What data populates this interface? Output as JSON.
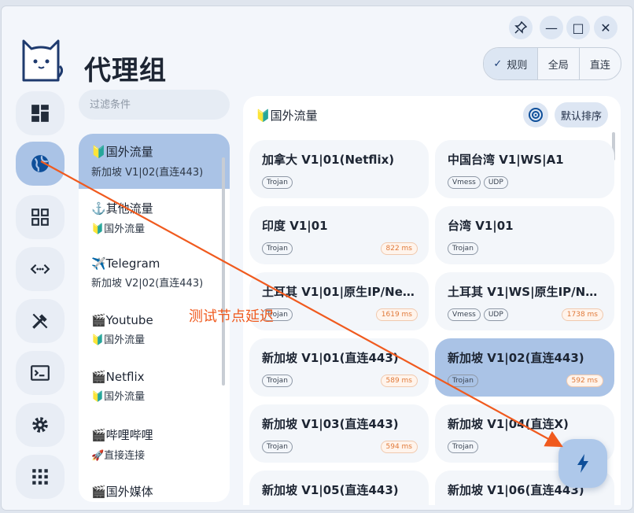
{
  "page": {
    "title": "代理组"
  },
  "window_controls": {
    "pin": "pin-icon",
    "minimize": "—",
    "maximize": "□",
    "close": "✕"
  },
  "mode": {
    "options": [
      "规则",
      "全局",
      "直连"
    ],
    "selected": "规则",
    "check": "✓"
  },
  "filter": {
    "placeholder": "过滤条件"
  },
  "sidebar": {
    "items": [
      {
        "icon": "dashboard-icon",
        "active": false
      },
      {
        "icon": "globe-icon",
        "active": true
      },
      {
        "icon": "grid-icon",
        "active": false
      },
      {
        "icon": "code-icon",
        "active": false
      },
      {
        "icon": "tools-icon",
        "active": false
      },
      {
        "icon": "terminal-icon",
        "active": false
      },
      {
        "icon": "gear-icon",
        "active": false
      },
      {
        "icon": "apps-icon",
        "active": false
      }
    ]
  },
  "groups": [
    {
      "name": "🔰国外流量",
      "sub": "新加坡 V1|02(直连443)",
      "active": true
    },
    {
      "name": "⚓️其他流量",
      "sub": "🔰国外流量",
      "active": false
    },
    {
      "name": "✈️Telegram",
      "sub": "新加坡 V2|02(直连443)",
      "active": false
    },
    {
      "name": "🎬Youtube",
      "sub": "🔰国外流量",
      "active": false
    },
    {
      "name": "🎬Netflix",
      "sub": "🔰国外流量",
      "active": false
    },
    {
      "name": "🎬哔哩哔哩",
      "sub": "🚀直接连接",
      "active": false
    },
    {
      "name": "🎬国外媒体",
      "sub": "",
      "active": false
    }
  ],
  "proxies_panel": {
    "header": "🔰国外流量",
    "sort_label": "默认排序"
  },
  "proxies": [
    {
      "name": "加拿大 V1|01(Netflix)",
      "tags": [
        "Trojan"
      ],
      "latency": ""
    },
    {
      "name": "中国台湾 V1|WS|A1",
      "tags": [
        "Vmess",
        "UDP"
      ],
      "latency": ""
    },
    {
      "name": "印度 V1|01",
      "tags": [
        "Trojan"
      ],
      "latency": "822 ms"
    },
    {
      "name": "台湾 V1|01",
      "tags": [
        "Trojan"
      ],
      "latency": ""
    },
    {
      "name": "土耳其 V1|01|原生IP/Net...",
      "tags": [
        "Trojan"
      ],
      "latency": "1619 ms"
    },
    {
      "name": "土耳其 V1|WS|原生IP/Net...",
      "tags": [
        "Vmess",
        "UDP"
      ],
      "latency": "1738 ms"
    },
    {
      "name": "新加坡 V1|01(直连443)",
      "tags": [
        "Trojan"
      ],
      "latency": "589 ms"
    },
    {
      "name": "新加坡 V1|02(直连443)",
      "tags": [
        "Trojan"
      ],
      "latency": "592 ms",
      "selected": true
    },
    {
      "name": "新加坡 V1|03(直连443)",
      "tags": [
        "Trojan"
      ],
      "latency": "594 ms"
    },
    {
      "name": "新加坡 V1|04(直连X)",
      "tags": [
        "Trojan"
      ],
      "latency": ""
    },
    {
      "name": "新加坡 V1|05(直连443)",
      "tags": [],
      "latency": ""
    },
    {
      "name": "新加坡 V1|06(直连443)",
      "tags": [],
      "latency": ""
    }
  ],
  "fab": {
    "icon": "bolt-icon"
  },
  "annotation": {
    "text": "测试节点延迟",
    "color": "#f05a1e"
  },
  "colors": {
    "accent": "#aac3e6",
    "latency": "#e07a3a",
    "background": "#f3f6fb"
  }
}
